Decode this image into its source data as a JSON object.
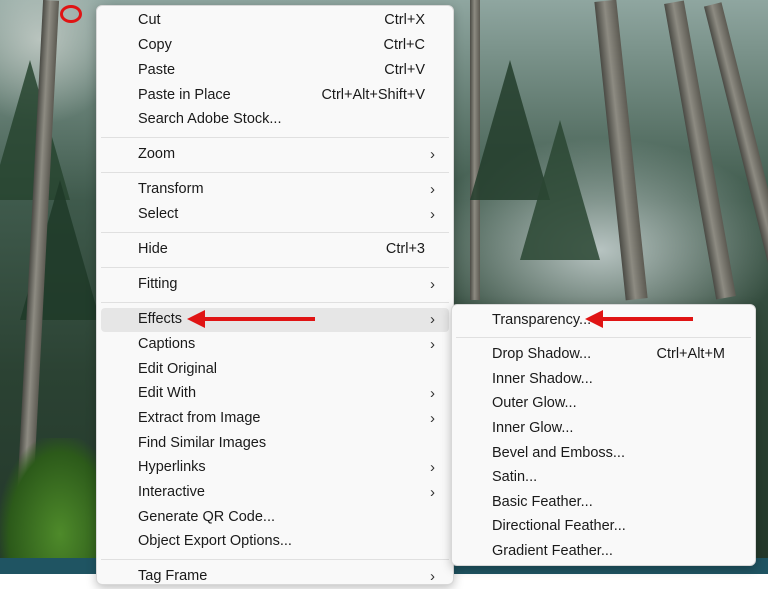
{
  "context_menu": {
    "items": [
      {
        "label": "Cut",
        "shortcut": "Ctrl+X"
      },
      {
        "label": "Copy",
        "shortcut": "Ctrl+C"
      },
      {
        "label": "Paste",
        "shortcut": "Ctrl+V"
      },
      {
        "label": "Paste in Place",
        "shortcut": "Ctrl+Alt+Shift+V"
      },
      {
        "label": "Search Adobe Stock..."
      },
      {
        "label": "Zoom"
      },
      {
        "label": "Transform"
      },
      {
        "label": "Select"
      },
      {
        "label": "Hide",
        "shortcut": "Ctrl+3"
      },
      {
        "label": "Fitting"
      },
      {
        "label": "Effects"
      },
      {
        "label": "Captions"
      },
      {
        "label": "Edit Original"
      },
      {
        "label": "Edit With"
      },
      {
        "label": "Extract from Image"
      },
      {
        "label": "Find Similar Images"
      },
      {
        "label": "Hyperlinks"
      },
      {
        "label": "Interactive"
      },
      {
        "label": "Generate QR Code..."
      },
      {
        "label": "Object Export Options..."
      },
      {
        "label": "Tag Frame"
      }
    ],
    "highlighted": "Effects"
  },
  "effects_submenu": {
    "items": [
      {
        "label": "Transparency..."
      },
      {
        "label": "Drop Shadow...",
        "shortcut": "Ctrl+Alt+M"
      },
      {
        "label": "Inner Shadow..."
      },
      {
        "label": "Outer Glow..."
      },
      {
        "label": "Inner Glow..."
      },
      {
        "label": "Bevel and Emboss..."
      },
      {
        "label": "Satin..."
      },
      {
        "label": "Basic Feather..."
      },
      {
        "label": "Directional Feather..."
      },
      {
        "label": "Gradient Feather..."
      }
    ]
  },
  "icons": {
    "submenu": "chevron-right-icon"
  },
  "chevron": "›",
  "colors": {
    "annotation": "#e01414",
    "menu_bg": "#f9f9f9",
    "highlight": "#e6e6e6"
  }
}
